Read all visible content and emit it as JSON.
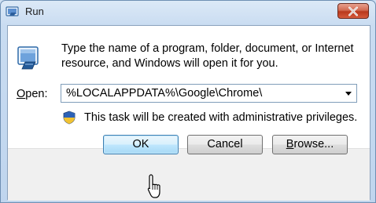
{
  "window": {
    "title": "Run"
  },
  "body": {
    "description": "Type the name of a program, folder, document, or Internet resource, and Windows will open it for you.",
    "open_label_prefix": "",
    "open_label_mnemonic": "O",
    "open_label_rest": "pen:",
    "open_value": "%LOCALAPPDATA%\\Google\\Chrome\\",
    "admin_notice": "This task will be created with administrative privileges."
  },
  "buttons": {
    "ok": "OK",
    "cancel": "Cancel",
    "browse_mnemonic": "B",
    "browse_rest": "rowse..."
  },
  "icons": {
    "title": "run-icon",
    "close": "close-icon",
    "run": "run-icon",
    "dropdown": "chevron-down-icon",
    "shield": "uac-shield-icon",
    "cursor": "mouse-pointer-icon"
  },
  "colors": {
    "close_button": "#c9452b",
    "default_button_border": "#3c7fb1",
    "field_border": "#7f9db9"
  }
}
